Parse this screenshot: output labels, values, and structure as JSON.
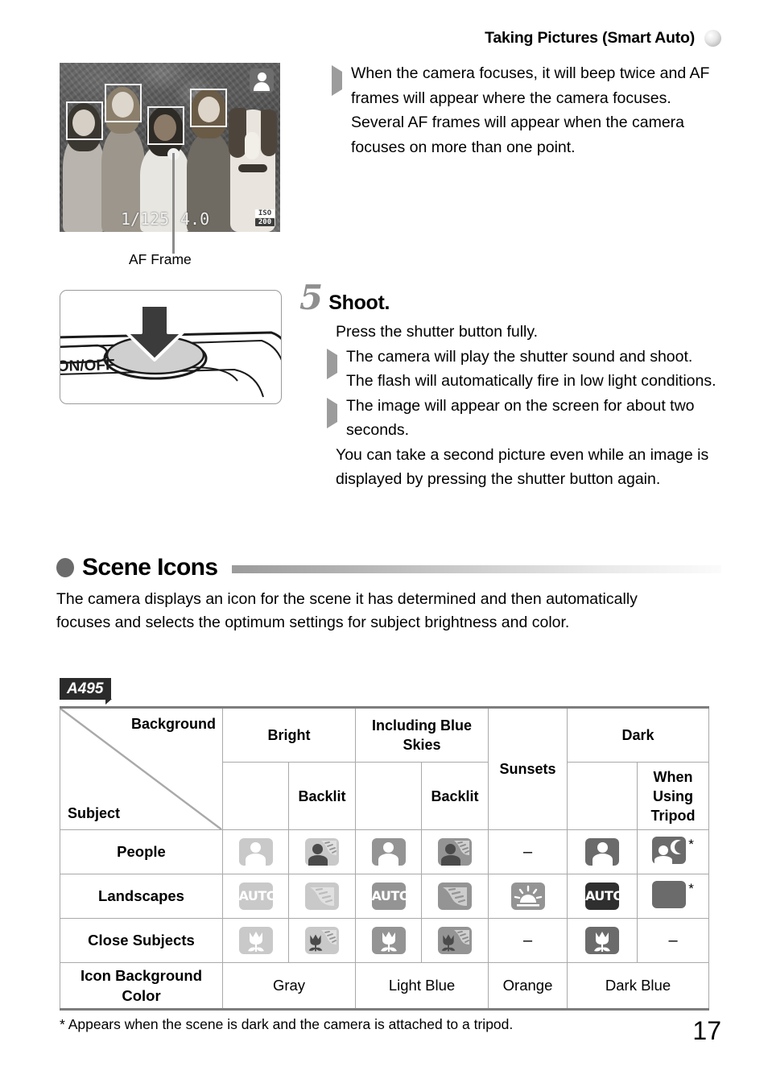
{
  "header": {
    "title": "Taking Pictures (Smart Auto)",
    "ball_icon": "sphere-icon"
  },
  "lcd_figure": {
    "shutter_speed": "1/125",
    "aperture": "4.0",
    "iso_top": "ISO",
    "iso_bottom": "200",
    "mode_icon": "portrait-scene-icon",
    "caption": "AF Frame"
  },
  "top_notes": [
    {
      "marker": "triangle",
      "text": "When the camera focuses, it will beep twice and AF frames will appear where the camera focuses."
    },
    {
      "marker": "none",
      "text": "Several AF frames will appear when the camera focuses on more than one point."
    }
  ],
  "shutter_figure": {
    "label": "ON/OFF",
    "icon": "press-shutter-arrow-icon"
  },
  "step": {
    "number": "5",
    "title": "Shoot.",
    "items": [
      {
        "marker": "dot",
        "text": "Press the shutter button fully."
      },
      {
        "marker": "triangle",
        "text": "The camera will play the shutter sound and shoot. The flash will automatically fire in low light conditions."
      },
      {
        "marker": "triangle",
        "text": "The image will appear on the screen for about two seconds."
      },
      {
        "marker": "dot",
        "text": "You can take a second picture even while an image is displayed by pressing the shutter button again."
      }
    ]
  },
  "scene_section": {
    "heading": "Scene Icons",
    "body": "The camera displays an icon for the scene it has determined and then automatically focuses and selects the optimum settings for subject brightness and color.",
    "model_badge": "A495"
  },
  "scene_table": {
    "corner": {
      "background_label": "Background",
      "subject_label": "Subject"
    },
    "group_headers": [
      "Bright",
      "Including Blue Skies",
      "Sunsets",
      "Dark"
    ],
    "sub_headers": {
      "bright_backlit": "Backlit",
      "blue_backlit": "Backlit",
      "dark_tripod": "When Using Tripod"
    },
    "rows": [
      {
        "label": "People",
        "cells": [
          {
            "icon": "person-icon",
            "bg": "bg-light",
            "fg": "white",
            "star": false
          },
          {
            "icon": "person-backlit-icon",
            "bg": "bg-light",
            "fg": "dark",
            "star": false
          },
          {
            "icon": "person-icon",
            "bg": "bg-mid",
            "fg": "white",
            "star": false
          },
          {
            "icon": "person-backlit-icon",
            "bg": "bg-mid",
            "fg": "dark",
            "star": false
          },
          {
            "icon": "dash",
            "text": "–"
          },
          {
            "icon": "person-icon",
            "bg": "bg-dark",
            "fg": "white",
            "star": false
          },
          {
            "icon": "person-night-icon",
            "bg": "bg-dark",
            "fg": "white",
            "star": true
          }
        ]
      },
      {
        "label": "Landscapes",
        "cells": [
          {
            "icon": "auto-icon",
            "bg": "bg-light",
            "text": "AUTO",
            "fg": "white",
            "star": false
          },
          {
            "icon": "backlit-icon",
            "bg": "bg-light",
            "fg": "white",
            "star": false
          },
          {
            "icon": "auto-icon",
            "bg": "bg-mid",
            "text": "AUTO",
            "fg": "white",
            "star": false
          },
          {
            "icon": "backlit-icon",
            "bg": "bg-mid",
            "fg": "white",
            "star": false
          },
          {
            "icon": "sunset-icon",
            "bg": "bg-mid",
            "fg": "white",
            "star": false
          },
          {
            "icon": "auto-icon",
            "bg": "bg-black",
            "text": "AUTO",
            "fg": "white",
            "star": false
          },
          {
            "icon": "night-icon",
            "bg": "bg-dark",
            "fg": "white",
            "star": true
          }
        ]
      },
      {
        "label": "Close Subjects",
        "cells": [
          {
            "icon": "macro-icon",
            "bg": "bg-light",
            "fg": "white",
            "star": false
          },
          {
            "icon": "macro-backlit-icon",
            "bg": "bg-light",
            "fg": "dark",
            "star": false
          },
          {
            "icon": "macro-icon",
            "bg": "bg-mid",
            "fg": "white",
            "star": false
          },
          {
            "icon": "macro-backlit-icon",
            "bg": "bg-mid",
            "fg": "dark",
            "star": false
          },
          {
            "icon": "dash",
            "text": "–"
          },
          {
            "icon": "macro-icon",
            "bg": "bg-dark",
            "fg": "white",
            "star": false
          },
          {
            "icon": "dash",
            "text": "–"
          }
        ]
      }
    ],
    "color_row": {
      "label": "Icon Background Color",
      "values": [
        "Gray",
        "Light Blue",
        "Orange",
        "Dark Blue"
      ]
    }
  },
  "footnote": "* Appears when the scene is dark and the camera is attached to a tripod.",
  "page_number": "17"
}
